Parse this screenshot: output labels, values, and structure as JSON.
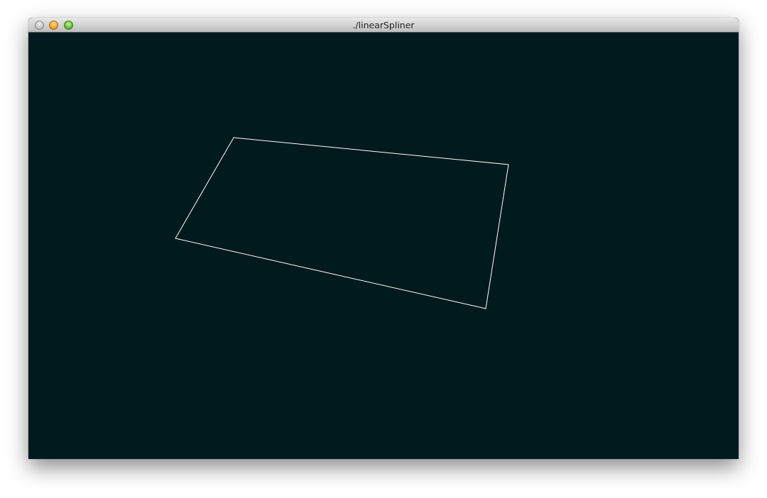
{
  "window": {
    "title": "./linearSpliner"
  },
  "canvas": {
    "background_color": "#001a1e",
    "stroke_color": "#ffffff",
    "shape": "closed-polygon"
  }
}
